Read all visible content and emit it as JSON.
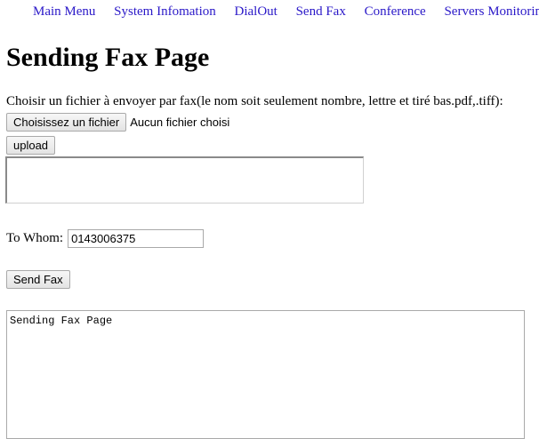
{
  "nav": {
    "items": [
      {
        "label": "Main Menu"
      },
      {
        "label": "System Infomation"
      },
      {
        "label": "DialOut"
      },
      {
        "label": "Send Fax"
      },
      {
        "label": "Conference"
      },
      {
        "label": "Servers Monitoring"
      }
    ],
    "link_color": "#2a18c8"
  },
  "page": {
    "title": "Sending Fax Page"
  },
  "upload": {
    "instruction": "Choisir un fichier à envoyer par fax(le nom soit seulement nombre, lettre et tiré bas.pdf,.tiff):",
    "choose_button_label": "Choisissez un fichier",
    "file_status": "Aucun fichier choisi",
    "upload_button_label": "upload"
  },
  "recipient": {
    "label": "To Whom:",
    "value": "0143006375"
  },
  "send": {
    "button_label": "Send Fax"
  },
  "log": {
    "text": "Sending Fax Page"
  }
}
